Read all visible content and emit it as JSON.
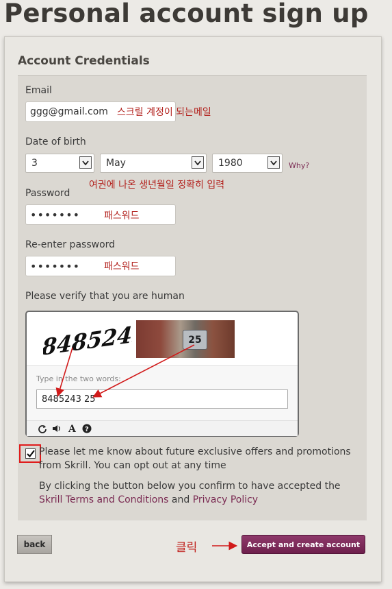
{
  "page": {
    "title": "Personal account sign up"
  },
  "section": {
    "title": "Account Credentials"
  },
  "email": {
    "label": "Email",
    "value": "ggg@gmail.com",
    "note": "스크릴 계정이 되는메일"
  },
  "dob": {
    "label": "Date of birth",
    "day": "3",
    "month": "May",
    "year": "1980",
    "why_link": "Why?",
    "note": "여권에 나온 생년월일 정확히 입력"
  },
  "password": {
    "label": "Password",
    "value": "•••••••",
    "note": "패스워드"
  },
  "reenter": {
    "label": "Re-enter password",
    "value": "•••••••",
    "note": "패스워드"
  },
  "captcha": {
    "prompt": "Please verify that you are human",
    "word1": "8485243",
    "plate_text": "25",
    "input_label": "Type in the two words:",
    "input_value": "8485243 25",
    "icons": [
      "refresh-icon",
      "audio-icon",
      "text-icon",
      "help-icon"
    ]
  },
  "offers": {
    "checked": true,
    "text": "Please let me know about future exclusive offers and promotions from Skrill. You can opt out at any time"
  },
  "terms": {
    "prefix": "By clicking the button below you confirm to have accepted the ",
    "terms_link": "Skrill Terms and Conditions",
    "middle": " and ",
    "privacy_link": "Privacy Policy"
  },
  "buttons": {
    "back": "back",
    "accept": "Accept and create account"
  },
  "annotation": {
    "click": "클릭"
  },
  "colors": {
    "brand": "#7a2a52",
    "annotation_red": "#c0201c",
    "panel": "#dbd8d2"
  }
}
